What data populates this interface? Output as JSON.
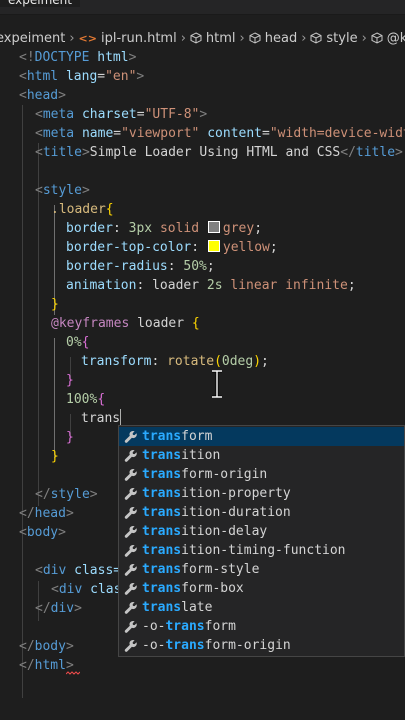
{
  "tab": {
    "label": "expeiment"
  },
  "breadcrumb": [
    {
      "label": "expeiment",
      "kind": "folder"
    },
    {
      "label": "ipl-run.html",
      "kind": "file",
      "icon": "html-file-icon",
      "icon_glyph": "<>"
    },
    {
      "label": "html",
      "kind": "element",
      "icon": "cube-icon"
    },
    {
      "label": "head",
      "kind": "element",
      "icon": "cube-icon"
    },
    {
      "label": "style",
      "kind": "element",
      "icon": "cube-icon"
    },
    {
      "label": "@ke",
      "kind": "element",
      "icon": "cube-icon"
    }
  ],
  "code": {
    "l1": {
      "open": "<!",
      "doctype": "DOCTYPE",
      "html": "html",
      "close": ">"
    },
    "l2": {
      "open": "<",
      "tag": "html",
      "attr": "lang",
      "eq": "=",
      "val": "\"en\"",
      "close": ">"
    },
    "l3": {
      "open": "<",
      "tag": "head",
      "close": ">"
    },
    "l4": {
      "open": "<",
      "tag": "meta",
      "attr": "charset",
      "eq": "=",
      "val": "\"UTF-8\"",
      "close": ">"
    },
    "l5": {
      "open": "<",
      "tag": "meta",
      "attr1": "name",
      "eq1": "=",
      "val1": "\"viewport\"",
      "attr2": "content",
      "eq2": "=",
      "val2": "\"width=device-widt"
    },
    "l6": {
      "open": "<",
      "tag": "title",
      "close": ">",
      "text": "Simple Loader Using HTML and CSS",
      "end_open": "</",
      "end_tag": "title",
      "end_close": ">"
    },
    "l8": {
      "open": "<",
      "tag": "style",
      "close": ">"
    },
    "l9": {
      "selector": ".loader",
      "brace": "{"
    },
    "l10": {
      "prop": "border",
      "colon": ":",
      "num": "3px",
      "word": "solid",
      "color_name": "grey",
      "swatch": "#808080",
      "semi": ";"
    },
    "l11": {
      "prop": "border-top-color",
      "colon": ":",
      "color_name": "yellow",
      "swatch": "#ffff00",
      "semi": ";"
    },
    "l12": {
      "prop": "border-radius",
      "colon": ":",
      "num": "50%",
      "semi": ";"
    },
    "l13": {
      "prop": "animation",
      "colon": ":",
      "name": "loader",
      "num": "2s",
      "kw1": "linear",
      "kw2": "infinite",
      "semi": ";"
    },
    "l14": {
      "brace": "}"
    },
    "l15": {
      "at": "@keyframes",
      "name": "loader",
      "brace": "{"
    },
    "l16": {
      "num": "0%",
      "brace": "{"
    },
    "l17": {
      "prop": "transform",
      "colon": ":",
      "fn": "rotate",
      "paren_open": "(",
      "num": "0deg",
      "paren_close": ")",
      "semi": ";"
    },
    "l18": {
      "brace": "}"
    },
    "l19": {
      "num": "100%",
      "brace": "{"
    },
    "l20": {
      "typed": "trans"
    },
    "l21": {
      "brace": "}"
    },
    "l22": {
      "brace": "}"
    },
    "l23": {
      "open": "</",
      "tag": "style",
      "close": ">"
    },
    "l24": {
      "open": "</",
      "tag": "head",
      "close": ">"
    },
    "l25": {
      "open": "<",
      "tag": "body",
      "close": ">"
    },
    "l27": {
      "open": "<",
      "tag": "div",
      "attr": "class="
    },
    "l28": {
      "open": "<",
      "tag": "div",
      "attr": "clas"
    },
    "l29": {
      "open": "</",
      "tag": "div",
      "close": ">"
    },
    "l31": {
      "open": "</",
      "tag": "body",
      "close": ">"
    },
    "l32": {
      "open": "</",
      "tag": "html",
      "close": ">"
    }
  },
  "suggestions": {
    "typed_prefix": "trans",
    "items": [
      {
        "match": "trans",
        "rest": "form",
        "selected": true
      },
      {
        "match": "trans",
        "rest": "ition"
      },
      {
        "match": "trans",
        "rest": "form-origin"
      },
      {
        "match": "trans",
        "rest": "ition-property"
      },
      {
        "match": "trans",
        "rest": "ition-duration"
      },
      {
        "match": "trans",
        "rest": "ition-delay"
      },
      {
        "match": "trans",
        "rest": "ition-timing-function"
      },
      {
        "match": "trans",
        "rest": "form-style"
      },
      {
        "match": "trans",
        "rest": "form-box"
      },
      {
        "match": "trans",
        "rest": "late"
      },
      {
        "prefix": "-o-",
        "match": "trans",
        "rest": "form"
      },
      {
        "prefix": "-o-",
        "match": "trans",
        "rest": "form-origin"
      }
    ]
  },
  "colors": {
    "background": "#1e1e1e",
    "tag": "#569cd6",
    "attribute": "#9cdcfe",
    "string": "#ce9178",
    "selector": "#d7ba7d",
    "number": "#b5cea8",
    "keyword": "#c586c0",
    "suggest_match": "#2aaaff",
    "suggest_selected": "#04395e"
  }
}
